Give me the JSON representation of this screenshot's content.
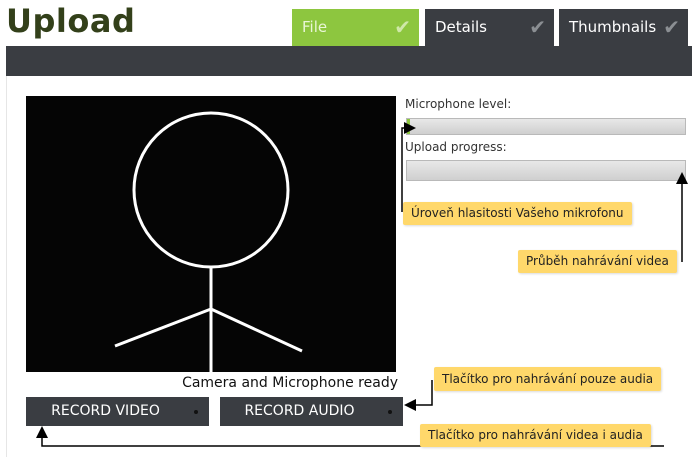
{
  "header": {
    "title": "Upload"
  },
  "tabs": [
    {
      "label": "File",
      "active": true,
      "completed": true
    },
    {
      "label": "Details",
      "active": false,
      "completed": true
    },
    {
      "label": "Thumbnails",
      "active": false,
      "completed": true
    }
  ],
  "recorder": {
    "status_text": "Camera and Microphone ready",
    "record_video_label": "RECORD VIDEO",
    "record_audio_label": "RECORD AUDIO"
  },
  "meters": {
    "mic_label": "Microphone level:",
    "mic_level": 0.01,
    "upload_label": "Upload progress:",
    "upload_progress": 0
  },
  "callouts": {
    "mic_level": "Úroveň hlasitosti Vašeho mikrofonu",
    "upload_progress": "Průběh nahrávání videa",
    "audio_button": "Tlačítko pro nahrávání pouze audia",
    "video_button": "Tlačítko pro nahrávání videa i audia"
  },
  "colors": {
    "accent": "#8dc63f",
    "dark": "#3a3d42",
    "callout": "#ffd86b",
    "title": "#33401a"
  }
}
